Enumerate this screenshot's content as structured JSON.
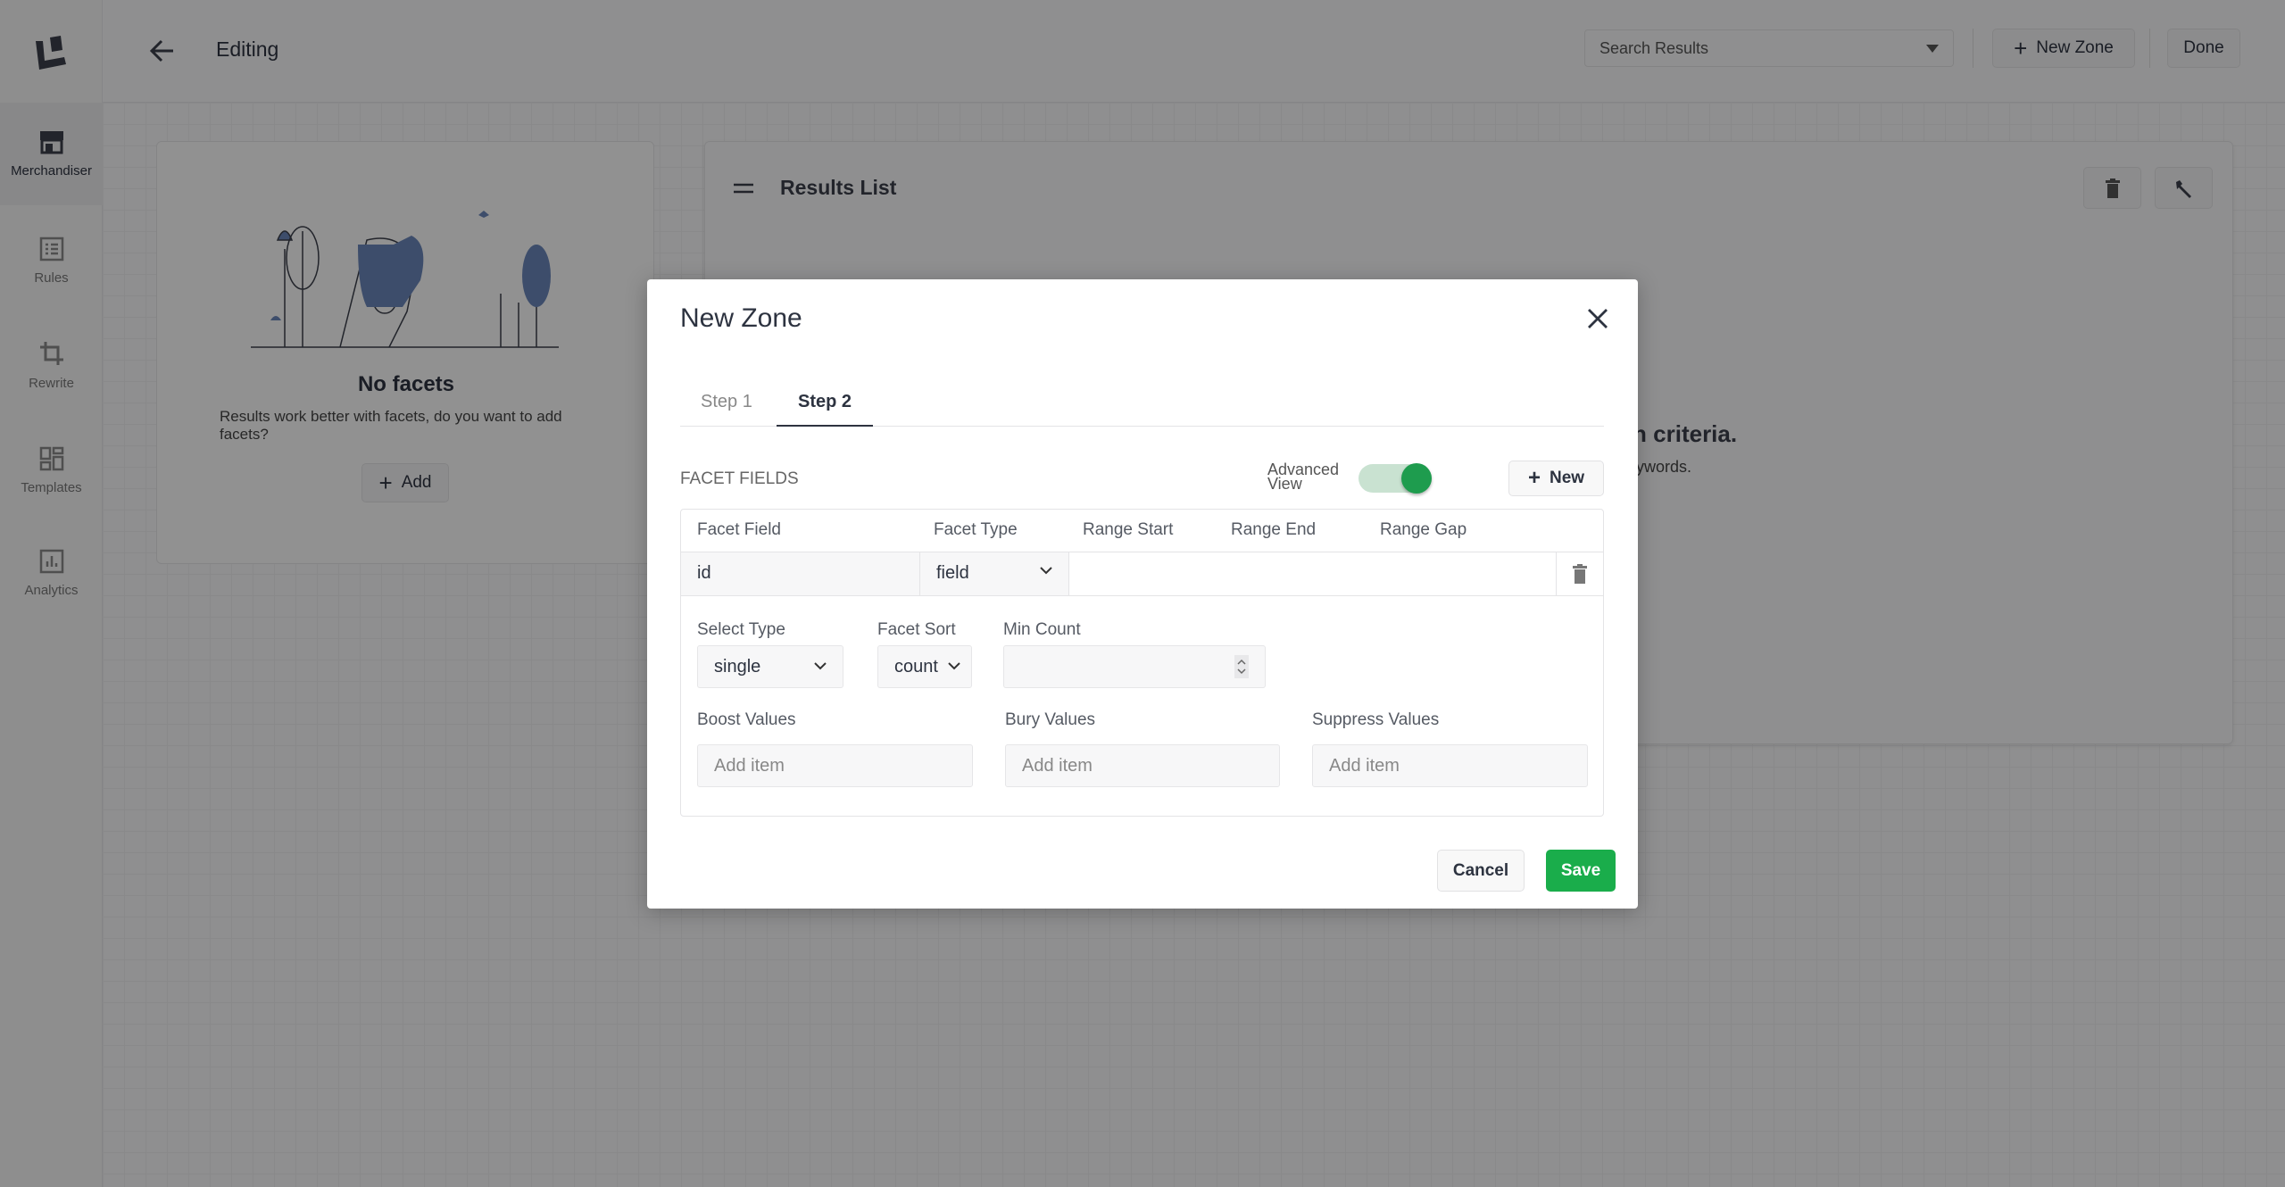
{
  "header": {
    "title": "Editing",
    "zone_select": "Search Results",
    "new_zone": "New Zone",
    "done": "Done"
  },
  "sidebar": {
    "items": [
      {
        "label": "Merchandiser",
        "icon": "store-icon"
      },
      {
        "label": "Rules",
        "icon": "list-icon"
      },
      {
        "label": "Rewrite",
        "icon": "crop-icon"
      },
      {
        "label": "Templates",
        "icon": "templates-icon"
      },
      {
        "label": "Analytics",
        "icon": "analytics-icon"
      }
    ]
  },
  "facets_card": {
    "title": "No facets",
    "text": "Results work better with facets, do you want to add facets?",
    "add": "Add"
  },
  "results_card": {
    "title": "Results List",
    "message": "arch criteria.",
    "sub": "eywords."
  },
  "modal": {
    "title": "New Zone",
    "tabs": [
      {
        "label": "Step 1",
        "active": false
      },
      {
        "label": "Step 2",
        "active": true
      }
    ],
    "section": "FACET FIELDS",
    "advanced_view": "Advanced View",
    "advanced_view_on": true,
    "new": "New",
    "columns": [
      "Facet Field",
      "Facet Type",
      "Range Start",
      "Range End",
      "Range Gap"
    ],
    "row": {
      "facet_field": "id",
      "facet_type": "field"
    },
    "select_type": {
      "label": "Select Type",
      "value": "single"
    },
    "facet_sort": {
      "label": "Facet Sort",
      "value": "count"
    },
    "min_count": {
      "label": "Min Count",
      "value": ""
    },
    "boost": {
      "label": "Boost Values",
      "placeholder": "Add item"
    },
    "bury": {
      "label": "Bury Values",
      "placeholder": "Add item"
    },
    "suppress": {
      "label": "Suppress Values",
      "placeholder": "Add item"
    },
    "cancel": "Cancel",
    "save": "Save"
  },
  "colors": {
    "accent": "#1aad4b",
    "toggle_knob": "#1e9c4e",
    "toggle_track": "#c9e2d1"
  }
}
